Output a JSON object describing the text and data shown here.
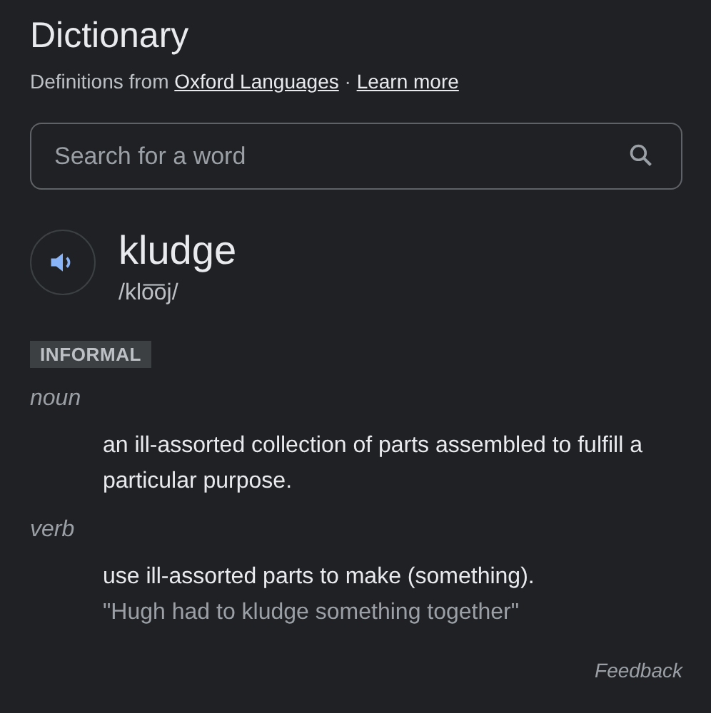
{
  "title": "Dictionary",
  "source": {
    "prefix": "Definitions from",
    "link": "Oxford Languages",
    "separator": "·",
    "more_link": "Learn more"
  },
  "search": {
    "placeholder": "Search for a word"
  },
  "entry": {
    "word": "kludge",
    "pronunciation": "/klo͞oj/",
    "register": "INFORMAL"
  },
  "senses": [
    {
      "part_of_speech": "noun",
      "definition": "an ill-assorted collection of parts assembled to fulfill a particular purpose."
    },
    {
      "part_of_speech": "verb",
      "definition": "use ill-assorted parts to make (something).",
      "example": "\"Hugh had to kludge something together\""
    }
  ],
  "feedback": "Feedback"
}
